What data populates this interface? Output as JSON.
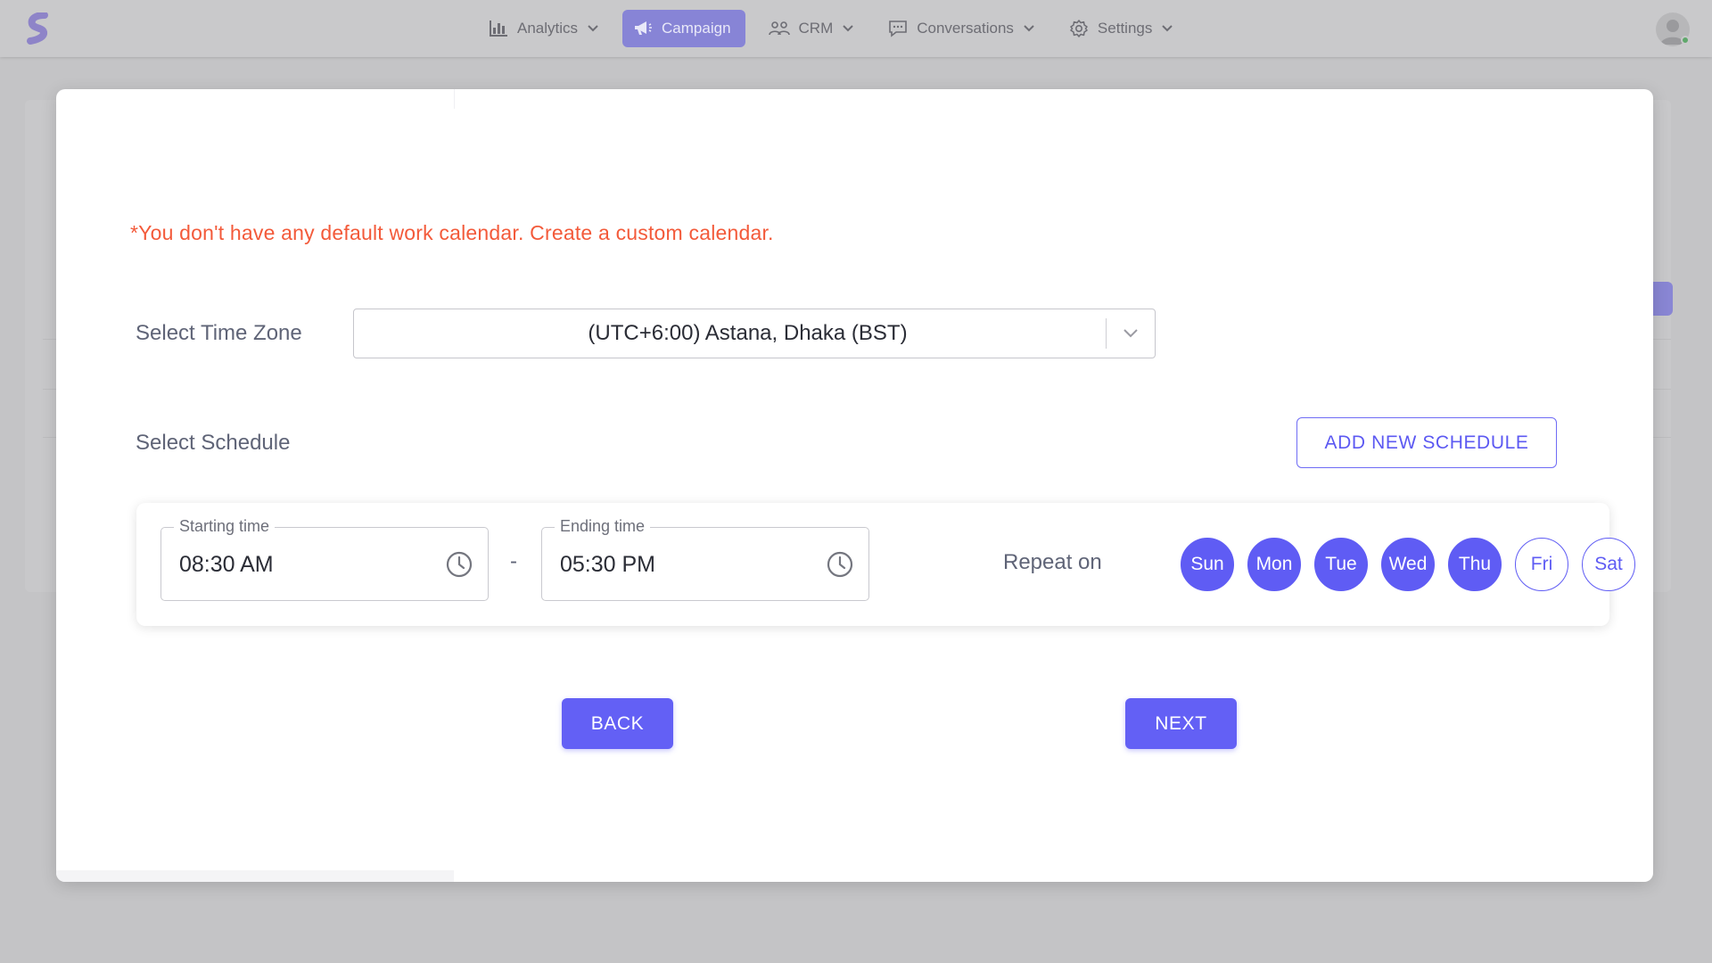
{
  "app": {
    "logo": "brand-s-logo"
  },
  "nav": {
    "items": [
      {
        "label": "Analytics",
        "icon": "bar-chart-icon",
        "active": false
      },
      {
        "label": "Campaign",
        "icon": "megaphone-icon",
        "active": true
      },
      {
        "label": "CRM",
        "icon": "users-icon",
        "active": false
      },
      {
        "label": "Conversations",
        "icon": "chat-icon",
        "active": false
      },
      {
        "label": "Settings",
        "icon": "gear-icon",
        "active": false
      }
    ]
  },
  "modal": {
    "warning": "*You don't have any default work calendar. Create a custom calendar.",
    "timezone": {
      "label": "Select Time Zone",
      "value": "(UTC+6:00) Astana, Dhaka (BST)"
    },
    "schedule": {
      "label": "Select Schedule",
      "add_button": "ADD NEW SCHEDULE",
      "starting_time_label": "Starting time",
      "starting_time": "08:30 AM",
      "separator": "-",
      "ending_time_label": "Ending time",
      "ending_time": "05:30 PM",
      "repeat_label": "Repeat on",
      "days": [
        {
          "label": "Sun",
          "selected": true
        },
        {
          "label": "Mon",
          "selected": true
        },
        {
          "label": "Tue",
          "selected": true
        },
        {
          "label": "Wed",
          "selected": true
        },
        {
          "label": "Thu",
          "selected": true
        },
        {
          "label": "Fri",
          "selected": false
        },
        {
          "label": "Sat",
          "selected": false
        }
      ]
    },
    "back_button": "BACK",
    "next_button": "NEXT"
  },
  "colors": {
    "accent": "#5f5cf4",
    "warning": "#f35a3a",
    "overlay": "#c4c4c6"
  }
}
